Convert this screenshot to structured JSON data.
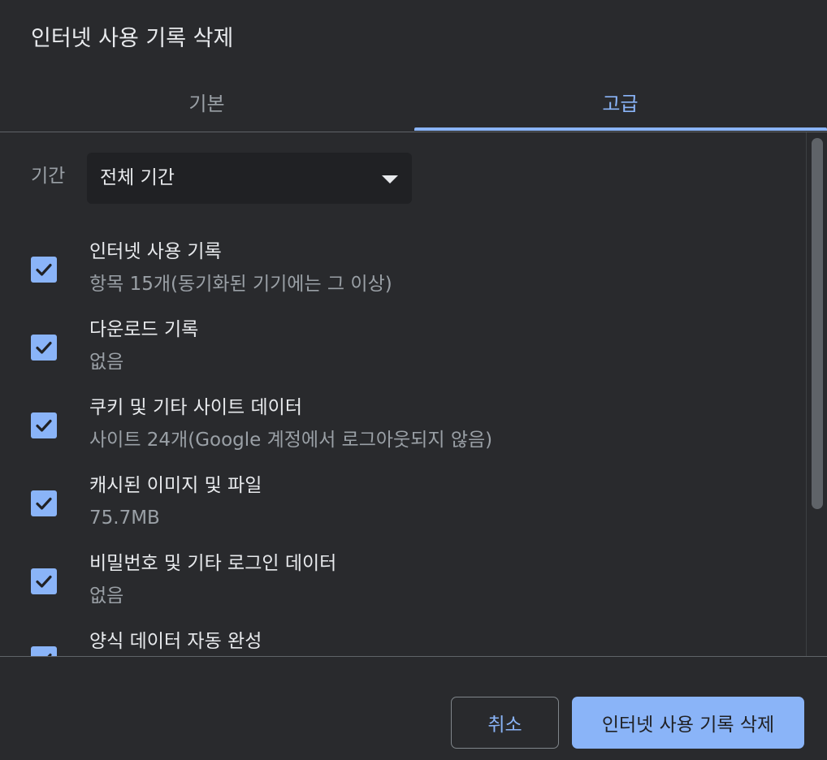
{
  "dialog": {
    "title": "인터넷 사용 기록 삭제"
  },
  "tabs": {
    "basic": "기본",
    "advanced": "고급",
    "active": "advanced"
  },
  "period": {
    "label": "기간",
    "selected": "전체 기간"
  },
  "items": [
    {
      "title": "인터넷 사용 기록",
      "sub": "항목 15개(동기화된 기기에는 그 이상)",
      "checked": true
    },
    {
      "title": "다운로드 기록",
      "sub": "없음",
      "checked": true
    },
    {
      "title": "쿠키 및 기타 사이트 데이터",
      "sub": "사이트 24개(Google 계정에서 로그아웃되지 않음)",
      "checked": true
    },
    {
      "title": "캐시된 이미지 및 파일",
      "sub": "75.7MB",
      "checked": true
    },
    {
      "title": "비밀번호 및 기타 로그인 데이터",
      "sub": "없음",
      "checked": true
    },
    {
      "title": "양식 데이터 자동 완성",
      "sub": "",
      "checked": true
    }
  ],
  "buttons": {
    "cancel": "취소",
    "clear": "인터넷 사용 기록 삭제"
  },
  "colors": {
    "accent": "#8ab4f8",
    "background": "#292a2d",
    "field": "#202124"
  },
  "icons": {
    "checkbox": "check-icon",
    "dropdown": "caret-down-icon"
  }
}
